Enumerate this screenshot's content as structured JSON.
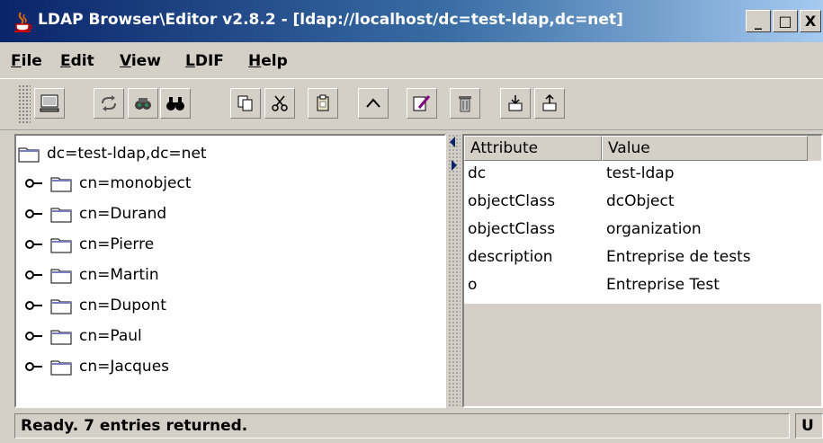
{
  "window": {
    "title": "LDAP Browser\\Editor v2.8.2 - [ldap://localhost/dc=test-ldap,dc=net]",
    "minimize_label": "_",
    "maximize_label": "□",
    "close_label": "X"
  },
  "menu": [
    {
      "label": "File",
      "mnemonic": "F"
    },
    {
      "label": "Edit",
      "mnemonic": "E"
    },
    {
      "label": "View",
      "mnemonic": "V"
    },
    {
      "label": "LDIF",
      "mnemonic": "L"
    },
    {
      "label": "Help",
      "mnemonic": "H"
    }
  ],
  "toolbar": {
    "buttons": [
      "connect-icon",
      "refresh-icon",
      "search-icon",
      "find-icon",
      "copy-icon",
      "cut-icon",
      "paste-icon",
      "up-icon",
      "edit-icon",
      "delete-icon",
      "export-icon",
      "import-icon"
    ]
  },
  "tree": {
    "root": "dc=test-ldap,dc=net",
    "children": [
      "cn=monobject",
      "cn=Durand",
      "cn=Pierre",
      "cn=Martin",
      "cn=Dupont",
      "cn=Paul",
      "cn=Jacques"
    ]
  },
  "attributes": {
    "columns": [
      "Attribute",
      "Value"
    ],
    "rows": [
      [
        "dc",
        "test-ldap"
      ],
      [
        "objectClass",
        "dcObject"
      ],
      [
        "objectClass",
        "organization"
      ],
      [
        "description",
        "Entreprise de tests"
      ],
      [
        "o",
        "Entreprise Test"
      ]
    ]
  },
  "status": {
    "message": "Ready. 7 entries returned.",
    "indicator": "U"
  },
  "colors": {
    "title_start": "#0a246a",
    "title_end": "#a6caf0",
    "chrome": "#d4d0c8"
  }
}
